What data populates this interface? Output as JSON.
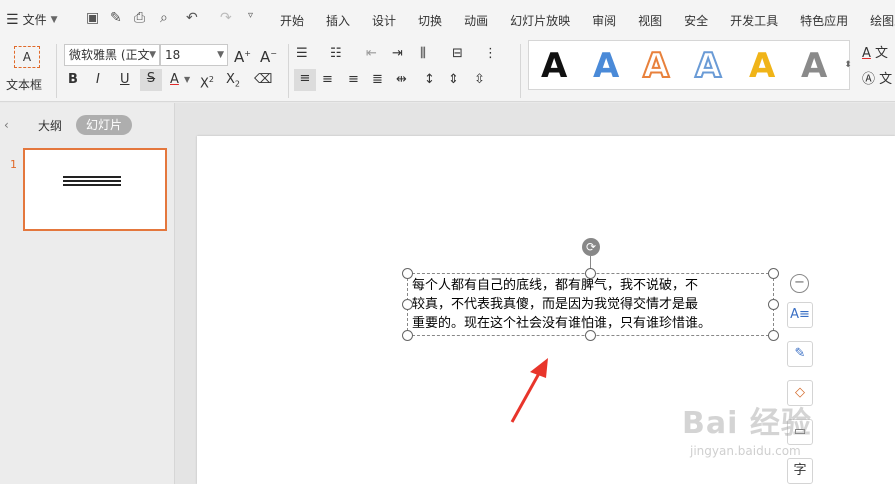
{
  "menubar": {
    "file_label": "文件",
    "tabs": [
      "开始",
      "插入",
      "设计",
      "切换",
      "动画",
      "幻灯片放映",
      "审阅",
      "视图",
      "安全",
      "开发工具",
      "特色应用",
      "绘图工具"
    ]
  },
  "ribbon": {
    "textbox_label": "文本框",
    "font_name": "微软雅黑 (正文",
    "font_size": "18",
    "text_style_glyph": "A",
    "right_label_1": "文",
    "right_label_2": "文",
    "colors": {
      "text_fill": "#e02b2b"
    }
  },
  "sidebar": {
    "tab_outline": "大纲",
    "tab_slides": "幻灯片",
    "thumb_number": "1"
  },
  "slide": {
    "text_lines": [
      "每个人都有自己的底线，都有脾气，我不说破，不",
      "较真，不代表我真傻，而是因为我觉得交情才是最",
      "重要的。现在这个社会没有谁怕谁，只有谁珍惜谁。"
    ],
    "annotation_color": "#e8352b"
  },
  "watermark": {
    "main": "Bai 经验",
    "sub": "jingyan.baidu.com"
  }
}
